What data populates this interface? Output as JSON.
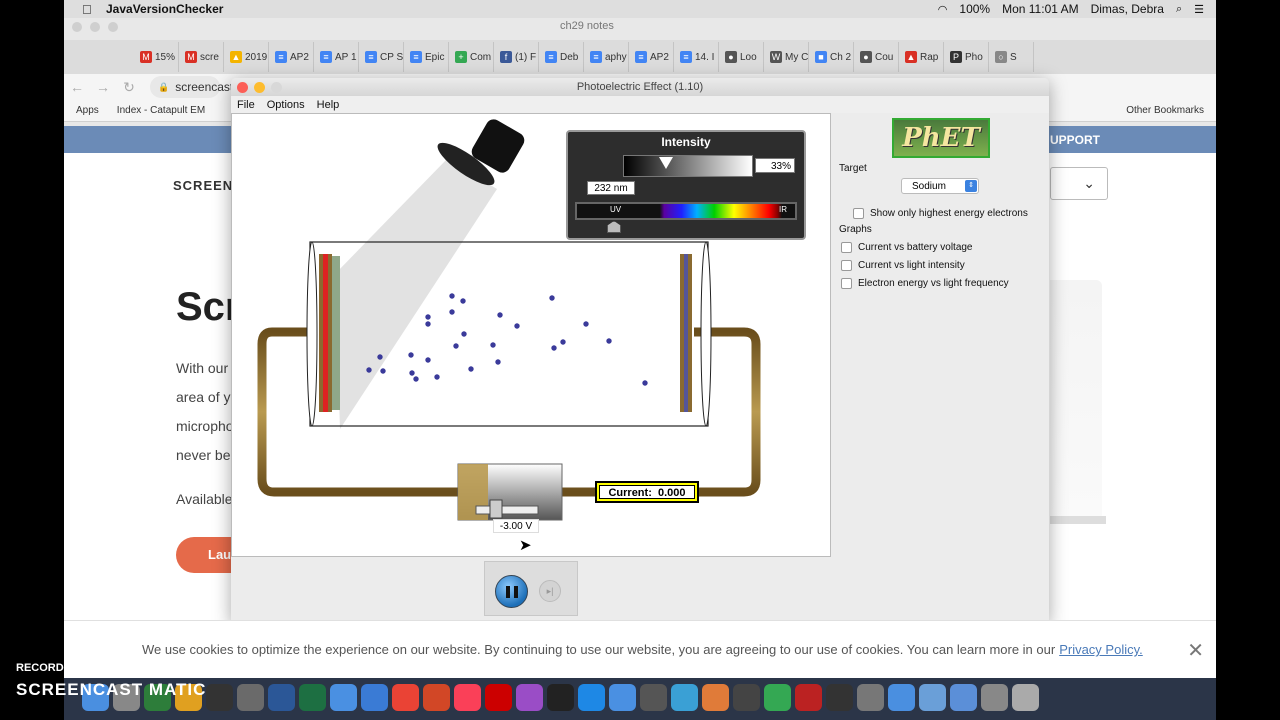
{
  "menubar": {
    "app_name": "JavaVersionChecker",
    "battery": "100%",
    "clock": "Mon 11:01 AM",
    "user": "Dimas, Debra"
  },
  "browser": {
    "window_title": "ch29 notes",
    "tabs": [
      {
        "label": "15%",
        "color": "#d93025",
        "glyph": "M"
      },
      {
        "label": "scre",
        "color": "#d93025",
        "glyph": "M"
      },
      {
        "label": "2019",
        "color": "#f4b400",
        "glyph": "▲"
      },
      {
        "label": "AP2",
        "color": "#4285f4",
        "glyph": "≡"
      },
      {
        "label": "AP 1",
        "color": "#4285f4",
        "glyph": "≡"
      },
      {
        "label": "CP S",
        "color": "#4285f4",
        "glyph": "≡"
      },
      {
        "label": "Epic",
        "color": "#4285f4",
        "glyph": "≡"
      },
      {
        "label": "Com",
        "color": "#34a853",
        "glyph": "+"
      },
      {
        "label": "(1) F",
        "color": "#3b5998",
        "glyph": "f"
      },
      {
        "label": "Deb",
        "color": "#4285f4",
        "glyph": "≡"
      },
      {
        "label": "aphy",
        "color": "#4285f4",
        "glyph": "≡"
      },
      {
        "label": "AP2",
        "color": "#4285f4",
        "glyph": "≡"
      },
      {
        "label": "14. I",
        "color": "#4285f4",
        "glyph": "≡"
      },
      {
        "label": "Loo",
        "color": "#555555",
        "glyph": "●"
      },
      {
        "label": "My C",
        "color": "#555555",
        "glyph": "W"
      },
      {
        "label": "Ch 2",
        "color": "#4285f4",
        "glyph": "■"
      },
      {
        "label": "Cou",
        "color": "#555555",
        "glyph": "●"
      },
      {
        "label": "Rap",
        "color": "#d93025",
        "glyph": "▲"
      },
      {
        "label": "Pho",
        "color": "#333333",
        "glyph": "P"
      },
      {
        "label": "S",
        "color": "#888888",
        "glyph": "○"
      }
    ],
    "url": "screencast",
    "bookmarks": {
      "apps": "Apps",
      "index": "Index - Catapult EM",
      "other": "Other Bookmarks"
    }
  },
  "website": {
    "support": "UPPORT",
    "brand": "SCREENC",
    "hero_title": "Scr",
    "lines": [
      "With our",
      "area of yo",
      "micropho",
      "never bee"
    ],
    "available": "Available",
    "launch_btn": "Lau",
    "cookie_text": "We use cookies to optimize the experience on our website. By continuing to use our website, you are agreeing to our use of cookies. You can learn more in our",
    "cookie_link": "Privacy Policy."
  },
  "recorder": {
    "recorded_with": "RECORDED WITH",
    "brand": "SCREENCAST  MATIC"
  },
  "phet": {
    "window_title": "Photoelectric Effect (1.10)",
    "menu": [
      "File",
      "Options",
      "Help"
    ],
    "logo": "PhET",
    "intensity_label": "Intensity",
    "intensity_percent": "33%",
    "intensity_value": 0.33,
    "wavelength": "232 nm",
    "uv_label": "UV",
    "ir_label": "IR",
    "current_label": "Current:",
    "current_value": "0.000",
    "voltage": "-3.00 V",
    "target_label": "Target",
    "target_value": "Sodium",
    "show_highest": "Show only highest energy electrons",
    "graphs_label": "Graphs",
    "graph_options": [
      "Current vs battery voltage",
      "Current vs light intensity",
      "Electron energy vs light frequency"
    ]
  }
}
